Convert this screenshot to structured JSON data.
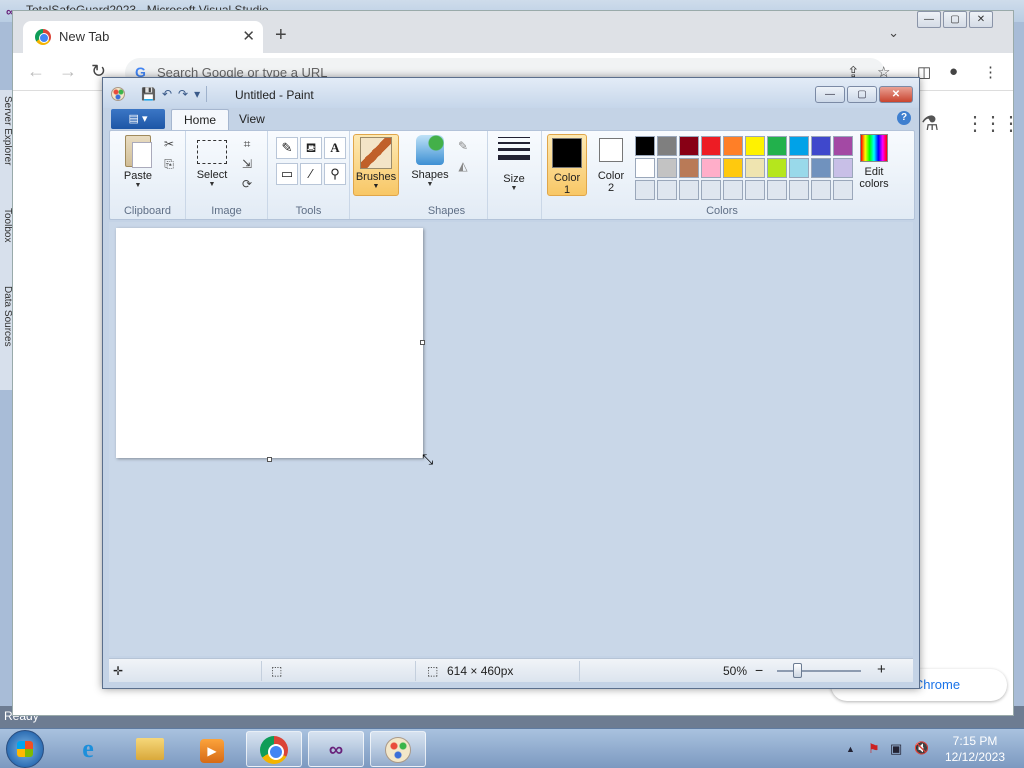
{
  "vs": {
    "title": "TotalSafeGuard2023 - Microsoft Visual Studio",
    "side_tabs": [
      "Server Explorer",
      "Toolbox",
      "Data Sources"
    ],
    "status": "Ready"
  },
  "chrome": {
    "tab_label": "New Tab",
    "tab_close": "✕",
    "new_tab": "+",
    "tab_list": "⌄",
    "omnibox_placeholder": "Search Google or type a URL",
    "back": "←",
    "forward": "→",
    "reload": "↻",
    "google_g": "G",
    "share": "⇪",
    "star": "☆",
    "side_panel": "◫",
    "profile": "●",
    "menu": "⋮",
    "labs": "⚗",
    "apps": "⋮⋮⋮",
    "customize_label": "e Chrome",
    "win_minimize": "—",
    "win_maximize": "▢",
    "win_close": "✕"
  },
  "paint": {
    "title": "Untitled - Paint",
    "qat": {
      "save": "💾",
      "undo": "↶",
      "redo": "↷",
      "customize": "▾"
    },
    "win": {
      "minimize": "—",
      "maximize": "▢",
      "close": "✕"
    },
    "file_menu": "▤ ▾",
    "tabs": [
      {
        "label": "Home"
      },
      {
        "label": "View"
      }
    ],
    "help": "?",
    "groups": {
      "clipboard": {
        "label": "Clipboard",
        "paste": "Paste",
        "cut": "✂",
        "copy": "⎘"
      },
      "image": {
        "label": "Image",
        "select": "Select",
        "crop": "⌗",
        "resize": "⇲",
        "rotate": "⟳"
      },
      "tools": {
        "label": "Tools",
        "pencil": "✎",
        "fill": "⛾",
        "text": "A",
        "eraser": "▭",
        "picker": "⁄",
        "magnifier": "⚲"
      },
      "brushes": {
        "label": "Brushes"
      },
      "shapes": {
        "label": "Shapes",
        "group_label": "Shapes",
        "outline": "✎",
        "fill": "◭"
      },
      "size": {
        "label": "Size"
      },
      "colors": {
        "label": "Colors",
        "color1": "Color\n1",
        "color1_line1": "Color",
        "color1_line2": "1",
        "color2_line1": "Color",
        "color2_line2": "2",
        "edit_line1": "Edit",
        "edit_line2": "colors"
      }
    },
    "color1_value": "#000000",
    "color2_value": "#ffffff",
    "palette": [
      "#000000",
      "#7f7f7f",
      "#880015",
      "#ed1c24",
      "#ff7f27",
      "#fff200",
      "#22b14c",
      "#00a2e8",
      "#3f48cc",
      "#a349a4",
      "#ffffff",
      "#c3c3c3",
      "#b97a57",
      "#ffaec9",
      "#ffc90e",
      "#efe4b0",
      "#b5e61d",
      "#99d9ea",
      "#7092be",
      "#c8bfe7",
      "#dfe6ef",
      "#dfe6ef",
      "#dfe6ef",
      "#dfe6ef",
      "#dfe6ef",
      "#dfe6ef",
      "#dfe6ef",
      "#dfe6ef",
      "#dfe6ef",
      "#dfe6ef"
    ],
    "status": {
      "move_icon": "✛",
      "selection_icon": "⬚",
      "size_icon": "⬚",
      "size": "614 × 460px",
      "zoom": "50%",
      "zoom_out": "−",
      "zoom_in": "+",
      "zoom_level": 0.5
    }
  },
  "taskbar": {
    "ie": "e",
    "media": "▶",
    "vs": "∞",
    "tray_arrow": "▲",
    "tray_flag": "⚑",
    "tray_network": "▣",
    "tray_volume": "🔇",
    "time": "7:15 PM",
    "date": "12/12/2023"
  }
}
